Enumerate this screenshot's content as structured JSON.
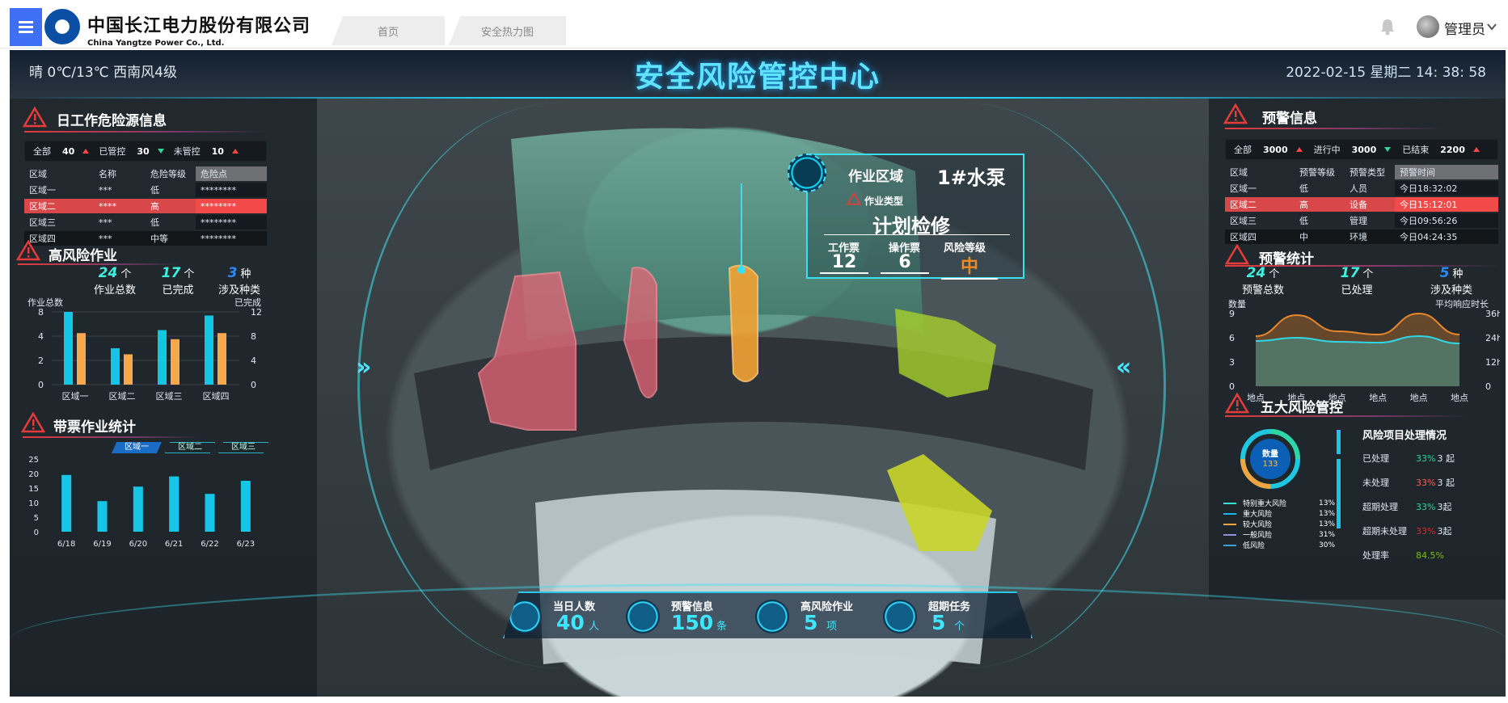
{
  "app": {
    "company_cn": "中国长江电力股份有限公司",
    "company_en": "China Yangtze Power Co., Ltd.",
    "tabs": [
      "首页",
      "安全热力图"
    ],
    "user": "管理员"
  },
  "header": {
    "weather": "晴  0℃/13℃  西南风4级",
    "title": "安全风险管控中心",
    "datetime": "2022-02-15  星期二  14: 38: 58"
  },
  "left": {
    "hazard": {
      "title": "日工作危险源信息",
      "stats": {
        "all_label": "全部",
        "all_value": "40",
        "controlled_label": "已管控",
        "controlled_value": "30",
        "uncontrolled_label": "未管控",
        "uncontrolled_value": "10"
      },
      "columns": [
        "区域",
        "名称",
        "危险等级",
        "危险点"
      ],
      "rows": [
        [
          "区域一",
          "***",
          "低",
          "********"
        ],
        [
          "区域二",
          "****",
          "高",
          "********"
        ],
        [
          "区域三",
          "***",
          "低",
          "********"
        ],
        [
          "区域四",
          "***",
          "中等",
          "********"
        ]
      ]
    },
    "highrisk": {
      "title": "高风险作业",
      "kpis": [
        {
          "value": "24",
          "unit": "个",
          "label": "作业总数"
        },
        {
          "value": "17",
          "unit": "个",
          "label": "已完成"
        },
        {
          "value": "3",
          "unit": "种",
          "label": "涉及种类"
        }
      ],
      "left_axis_label": "作业总数",
      "right_axis_label": "已完成"
    },
    "tickets": {
      "title": "带票作业统计",
      "tabs": [
        "区域一",
        "区域二",
        "区域三"
      ]
    }
  },
  "center": {
    "zone_label": "作业区域",
    "zone_value": "1#水泵",
    "type_label": "作业类型",
    "type_value": "计划检修",
    "m1_label": "工作票",
    "m1_value": "12",
    "m2_label": "操作票",
    "m2_value": "6",
    "m3_label": "风险等级",
    "m3_value": "中"
  },
  "bottom": [
    {
      "label": "当日人数",
      "value": "40",
      "unit": "人"
    },
    {
      "label": "预警信息",
      "value": "150",
      "unit": "条"
    },
    {
      "label": "高风险作业",
      "value": "5",
      "unit": "项"
    },
    {
      "label": "超期任务",
      "value": "5",
      "unit": "个"
    }
  ],
  "right": {
    "alerts": {
      "title": "预警信息",
      "stats": {
        "all_label": "全部",
        "all_value": "3000",
        "progress_label": "进行中",
        "progress_value": "3000",
        "ended_label": "已结束",
        "ended_value": "2200"
      },
      "columns": [
        "区域",
        "预警等级",
        "预警类型",
        "预警时间"
      ],
      "rows": [
        [
          "区域一",
          "低",
          "人员",
          "今日18:32:02"
        ],
        [
          "区域二",
          "高",
          "设备",
          "今日15:12:01"
        ],
        [
          "区域三",
          "低",
          "管理",
          "今日09:56:26"
        ],
        [
          "区域四",
          "中",
          "环境",
          "今日04:24:35"
        ]
      ]
    },
    "alert_stats": {
      "title": "预警统计",
      "kpis": [
        {
          "value": "24",
          "unit": "个",
          "label": "预警总数"
        },
        {
          "value": "17",
          "unit": "个",
          "label": "已处理"
        },
        {
          "value": "5",
          "unit": "种",
          "label": "涉及种类"
        }
      ],
      "left_axis_label": "数量",
      "right_axis_label": "平均响应时长"
    },
    "five_risks": {
      "title": "五大风险管控",
      "donut_label": "数量",
      "donut_value": "133",
      "legend": [
        {
          "name": "特别重大风险",
          "pct": "13%",
          "color": "#35e0d8"
        },
        {
          "name": "重大风险",
          "pct": "13%",
          "color": "#1fb5f0"
        },
        {
          "name": "较大风险",
          "pct": "13%",
          "color": "#f0a640"
        },
        {
          "name": "一般风险",
          "pct": "31%",
          "color": "#8f8fdc"
        },
        {
          "name": "低风险",
          "pct": "30%",
          "color": "#3aa0d6"
        }
      ],
      "status_title": "风险项目处理情况",
      "status": [
        {
          "label": "已处理",
          "pct": "33%",
          "count": "3 起",
          "color": "#2fd39a"
        },
        {
          "label": "未处理",
          "pct": "33%",
          "count": "3 起",
          "color": "#ff5a5a"
        },
        {
          "label": "超期处理",
          "pct": "33%",
          "count": "3起",
          "color": "#2fd39a"
        },
        {
          "label": "超期未处理",
          "pct": "33%",
          "count": "3起",
          "color": "#d82a2a"
        },
        {
          "label": "处理率",
          "pct": "84.5%",
          "count": "",
          "color": "#7bb81f"
        }
      ]
    }
  },
  "chart_data": [
    {
      "type": "bar",
      "title": "高风险作业",
      "categories": [
        "区域一",
        "区域二",
        "区域三",
        "区域四"
      ],
      "series": [
        {
          "name": "作业总数",
          "values": [
            2.0,
            1.0,
            1.5,
            1.9
          ],
          "color": "#13c6e6"
        },
        {
          "name": "已完成",
          "values": [
            8.5,
            5.0,
            7.5,
            8.5
          ],
          "color": "#f5a84d"
        }
      ],
      "left_ylim": [
        0,
        2
      ],
      "left_ticks": [
        0,
        1,
        2
      ],
      "left_tick_labels": [
        "0",
        "2",
        "4",
        "8"
      ],
      "right_ylim": [
        0,
        12
      ],
      "right_ticks": [
        "0",
        "4",
        "8",
        "12"
      ],
      "ylabel": "作业总数",
      "ylabel_right": "已完成"
    },
    {
      "type": "bar",
      "title": "带票作业统计",
      "categories": [
        "6/18",
        "6/19",
        "6/20",
        "6/21",
        "6/22",
        "6/23"
      ],
      "values": [
        19.5,
        10.5,
        15.5,
        19,
        13,
        17.5
      ],
      "ylim": [
        0,
        25
      ],
      "yticks": [
        0,
        5,
        10,
        15,
        20,
        25
      ]
    },
    {
      "type": "area",
      "title": "预警统计",
      "categories": [
        "地点",
        "地点",
        "地点",
        "地点",
        "地点",
        "地点"
      ],
      "series": [
        {
          "name": "数量",
          "values": [
            6.2,
            8.8,
            6.8,
            6.4,
            9.0,
            6.4
          ],
          "color": "#e8862c"
        },
        {
          "name": "平均响应时长",
          "values": [
            5.6,
            6.0,
            5.5,
            5.4,
            6.2,
            5.3
          ],
          "color": "#2fd7e6"
        }
      ],
      "ylim": [
        0,
        9
      ],
      "yticks": [
        0,
        3,
        6,
        9
      ],
      "right_ticks": [
        "0",
        "12h",
        "24h",
        "36h"
      ],
      "ylabel": "数量",
      "ylabel_right": "平均响应时长"
    }
  ]
}
